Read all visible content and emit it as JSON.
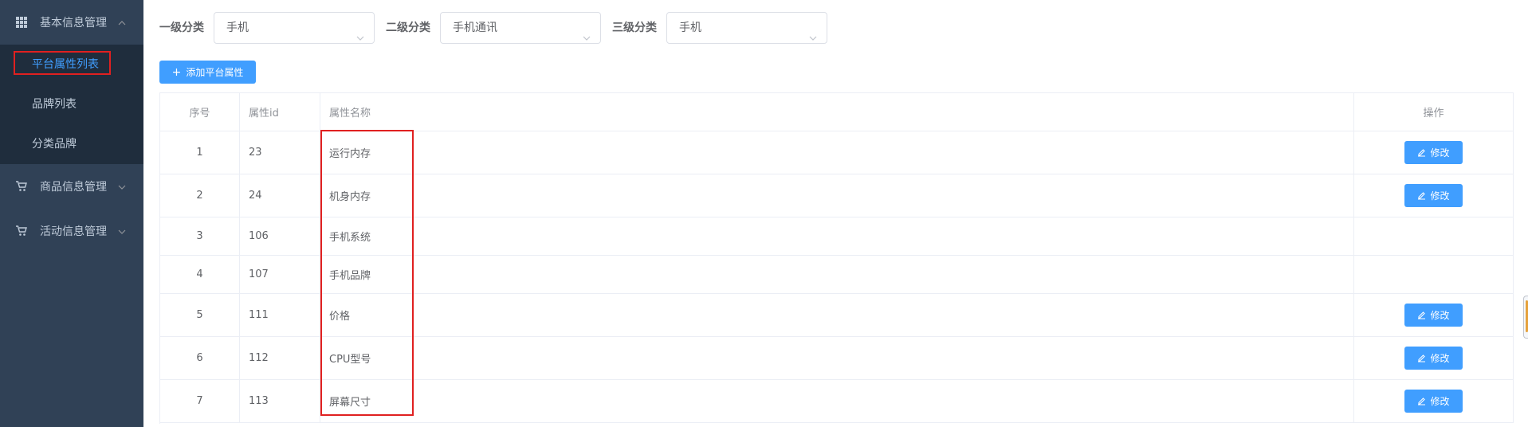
{
  "sidebar": {
    "menus": [
      {
        "label": "基本信息管理",
        "icon": "grid-icon",
        "expanded": true,
        "items": [
          {
            "label": "平台属性列表",
            "active": true
          },
          {
            "label": "品牌列表",
            "active": false
          },
          {
            "label": "分类品牌",
            "active": false
          }
        ]
      },
      {
        "label": "商品信息管理",
        "icon": "cart-icon",
        "expanded": false
      },
      {
        "label": "活动信息管理",
        "icon": "cart-icon",
        "expanded": false
      }
    ]
  },
  "filters": {
    "level1_label": "一级分类",
    "level1_value": "手机",
    "level2_label": "二级分类",
    "level2_value": "手机通讯",
    "level3_label": "三级分类",
    "level3_value": "手机"
  },
  "toolbar": {
    "add_label": "添加平台属性"
  },
  "table": {
    "columns": [
      "序号",
      "属性id",
      "属性名称",
      "操作"
    ],
    "edit_label": "修改",
    "rows": [
      {
        "index": "1",
        "id": "23",
        "name": "运行内存",
        "editable": true
      },
      {
        "index": "2",
        "id": "24",
        "name": "机身内存",
        "editable": true
      },
      {
        "index": "3",
        "id": "106",
        "name": "手机系统",
        "editable": false
      },
      {
        "index": "4",
        "id": "107",
        "name": "手机品牌",
        "editable": false
      },
      {
        "index": "5",
        "id": "111",
        "name": "价格",
        "editable": true
      },
      {
        "index": "6",
        "id": "112",
        "name": "CPU型号",
        "editable": true
      },
      {
        "index": "7",
        "id": "113",
        "name": "屏幕尺寸",
        "editable": true
      }
    ]
  },
  "colors": {
    "sidebar_bg": "#304156",
    "submenu_bg": "#1f2d3d",
    "active_text": "#409eff",
    "primary": "#409eff",
    "highlight_border": "#e02020"
  }
}
